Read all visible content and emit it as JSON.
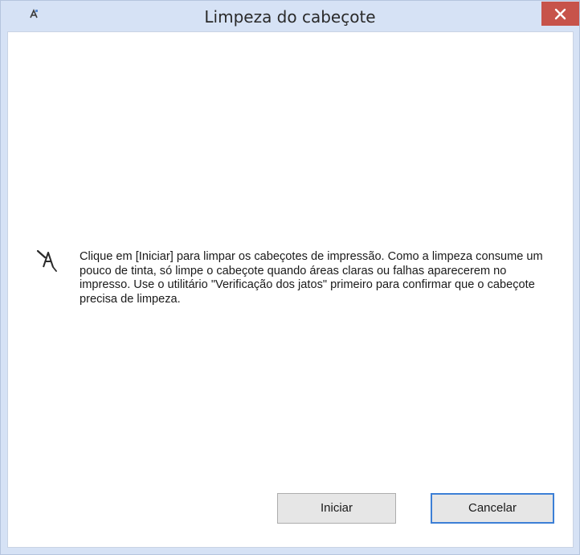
{
  "window": {
    "title": "Limpeza do cabeçote",
    "icon": "printer-app-icon",
    "close_icon": "close-icon"
  },
  "content": {
    "icon": "print-head-cleaning-icon",
    "message": "Clique em [Iniciar] para limpar os cabeçotes de impressão. Como a limpeza consume um pouco de tinta, só limpe o cabeçote quando áreas claras ou falhas aparecerem no impresso. Use o utilitário \"Verificação dos jatos\" primeiro para confirmar que o cabeçote precisa de limpeza."
  },
  "buttons": {
    "start_label": "Iniciar",
    "cancel_label": "Cancelar"
  },
  "colors": {
    "titlebar": "#d6e2f5",
    "close_button": "#c7534a",
    "focus_border": "#3c7fd6",
    "button_face": "#e6e6e6"
  }
}
